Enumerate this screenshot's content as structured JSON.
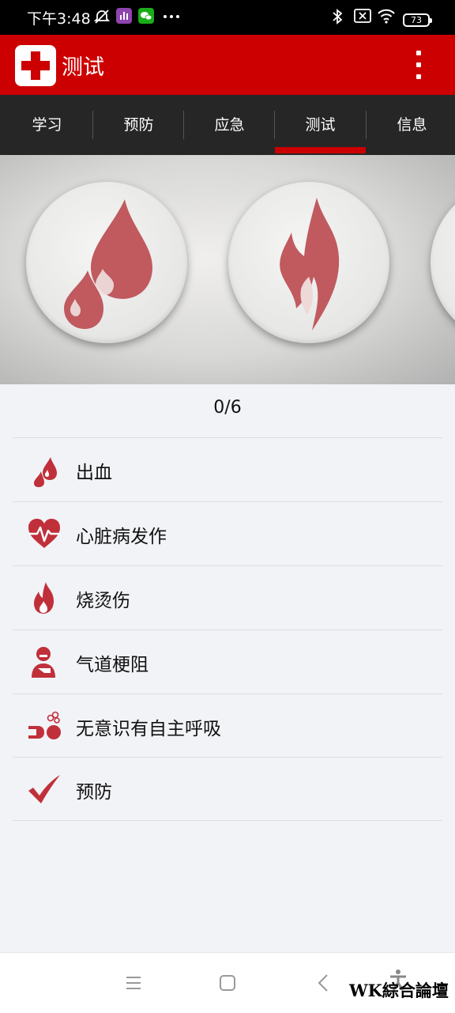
{
  "status_bar": {
    "time": "下午3:48",
    "battery": "73",
    "icons": [
      "mute-alarm-icon",
      "stats-app-icon",
      "wechat-icon",
      "more-dots-icon",
      "bluetooth-icon",
      "sim-x-icon",
      "wifi-icon",
      "battery-icon"
    ]
  },
  "app_bar": {
    "title": "测试",
    "logo": "red-cross-icon",
    "menu": "overflow-menu-icon"
  },
  "tabs": [
    {
      "label": "学习"
    },
    {
      "label": "预防"
    },
    {
      "label": "应急"
    },
    {
      "label": "测试",
      "selected": true
    },
    {
      "label": "信息"
    }
  ],
  "hero": {
    "icons": [
      "blood-drops-icon",
      "flame-icon",
      "next-topic-icon"
    ]
  },
  "score": "0/6",
  "topics": [
    {
      "label": "出血",
      "icon": "blood-drops-icon"
    },
    {
      "label": "心脏病发作",
      "icon": "heartbeat-icon"
    },
    {
      "label": "烧烫伤",
      "icon": "flame-icon"
    },
    {
      "label": "气道梗阻",
      "icon": "choking-person-icon"
    },
    {
      "label": "无意识有自主呼吸",
      "icon": "unconscious-breathing-icon"
    },
    {
      "label": "预防",
      "icon": "checkmark-icon"
    }
  ],
  "nav_bar": {
    "buttons": [
      "menu-icon",
      "home-icon",
      "back-icon",
      "accessibility-icon"
    ]
  },
  "watermark": "WK綜合論壇",
  "colors": {
    "brand_red": "#cc0000",
    "icon_red": "#c0303a",
    "tab_bg": "#262626",
    "list_bg": "#f2f3f7"
  }
}
